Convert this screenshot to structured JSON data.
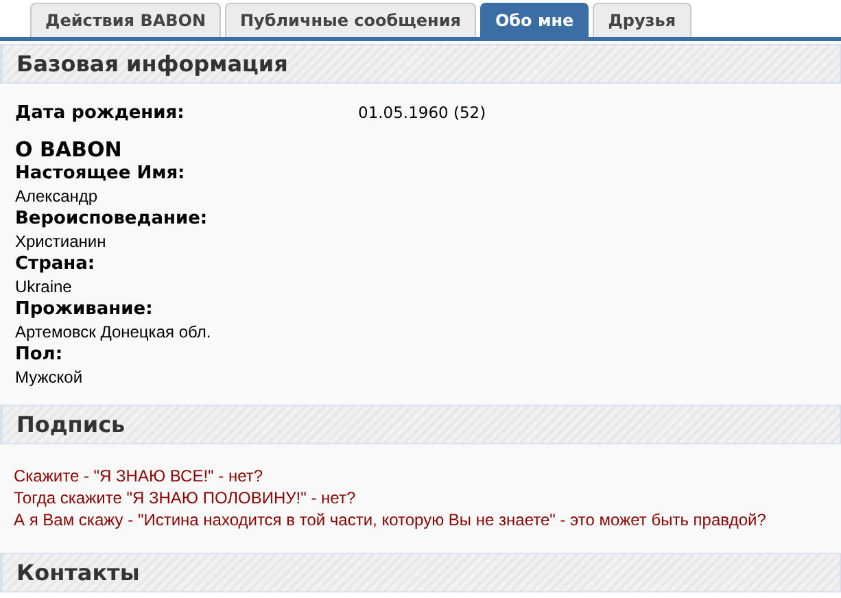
{
  "tabs": [
    {
      "label": "Действия BABON",
      "selected": false
    },
    {
      "label": "Публичные сообщения",
      "selected": false
    },
    {
      "label": "Обо мне",
      "selected": true
    },
    {
      "label": "Друзья",
      "selected": false
    }
  ],
  "sections": [
    {
      "kind": "profile",
      "title": "Базовая информация",
      "birth": {
        "label": "Дата рождения:",
        "value": "01.05.1960 (52)"
      },
      "about": {
        "title": "О BABON",
        "fields": [
          {
            "label": "Настоящее Имя:",
            "value": "Александр"
          },
          {
            "label": "Вероисповедание:",
            "value": "Христианин"
          },
          {
            "label": "Страна:",
            "value": "Ukraine"
          },
          {
            "label": "Проживание:",
            "value": "Артемовск Донецкая обл."
          },
          {
            "label": "Пол:",
            "value": "Мужской"
          }
        ]
      }
    },
    {
      "kind": "signature",
      "title": "Подпись",
      "lines": [
        "Скажите - \"Я ЗНАЮ ВСЕ!\" - нет?",
        "Тогда скажите \"Я ЗНАЮ ПОЛОВИНУ!\" - нет?",
        "А я Вам скажу - \"Истина находится в той части, которую Вы не знаете\" - это может быть правдой?"
      ]
    },
    {
      "kind": "empty",
      "title": "Контакты"
    }
  ]
}
